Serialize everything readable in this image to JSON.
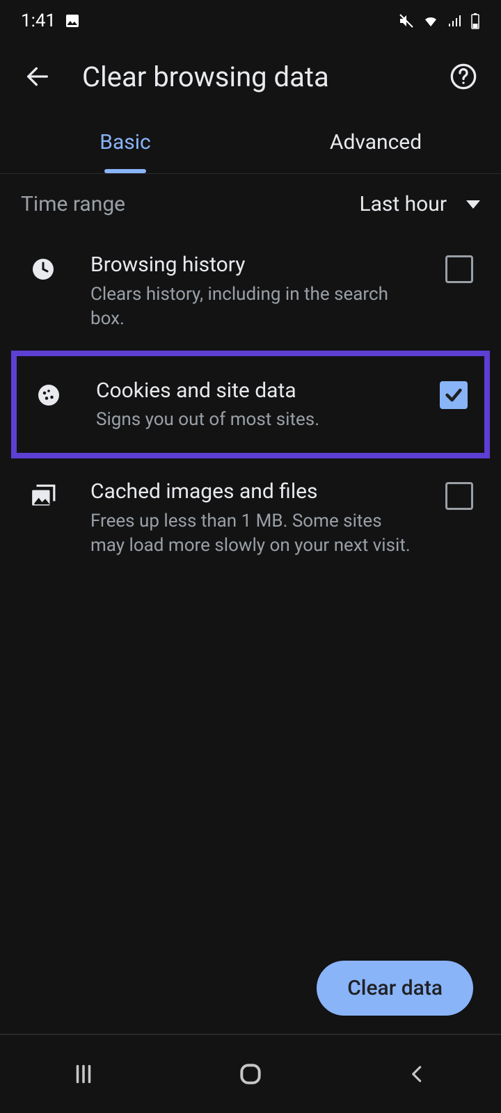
{
  "statusbar": {
    "time": "1:41"
  },
  "appbar": {
    "title": "Clear browsing data"
  },
  "tabs": {
    "basic": "Basic",
    "advanced": "Advanced",
    "active": "basic"
  },
  "timerange": {
    "label": "Time range",
    "value": "Last hour"
  },
  "items": [
    {
      "key": "browsing-history",
      "title": "Browsing history",
      "subtitle": "Clears history, including in the search box.",
      "checked": false
    },
    {
      "key": "cookies",
      "title": "Cookies and site data",
      "subtitle": "Signs you out of most sites.",
      "checked": true,
      "highlighted": true
    },
    {
      "key": "cached",
      "title": "Cached images and files",
      "subtitle": "Frees up less than 1 MB. Some sites may load more slowly on your next visit.",
      "checked": false
    }
  ],
  "action": {
    "clear_label": "Clear data"
  }
}
